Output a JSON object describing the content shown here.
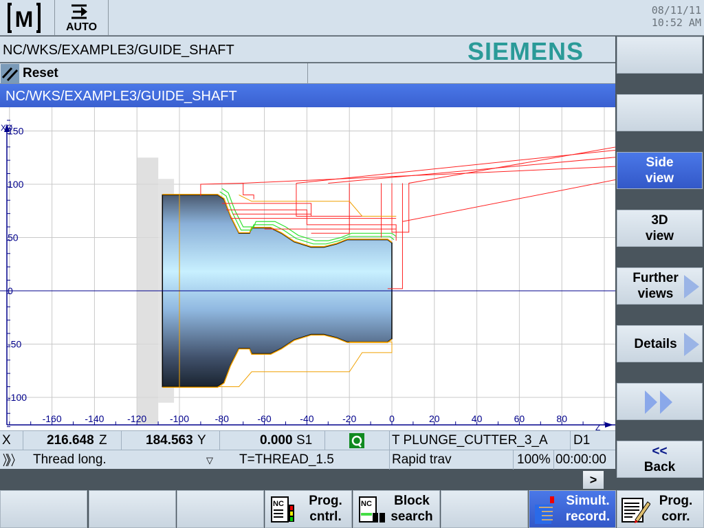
{
  "header": {
    "mode_icon": "machine-M-icon",
    "mode_label": "AUTO",
    "date": "08/11/11",
    "time": "10:52 AM"
  },
  "program_path": "NC/WKS/EXAMPLE3/GUIDE_SHAFT",
  "brand": "SIEMENS",
  "channel_status": "Reset",
  "window_title": "NC/WKS/EXAMPLE3/GUIDE_SHAFT",
  "plot": {
    "x_axis_label": "Z",
    "y_axis_label": "XØ",
    "x_ticks": [
      "-160",
      "-140",
      "-120",
      "-100",
      "-80",
      "-60",
      "-40",
      "-20",
      "0",
      "20",
      "40",
      "60",
      "80"
    ],
    "y_ticks": [
      "150",
      "100",
      "50",
      "0",
      "-50",
      "-100"
    ],
    "colors": {
      "rapid": "#ff2020",
      "feed": "#f0a000",
      "tool": "#30e030",
      "axis": "#00008b",
      "grid": "#c8c8c8"
    }
  },
  "status": {
    "x_label": "X",
    "x_value": "216.648",
    "z_label": "Z",
    "z_value": "184.563",
    "y_label": "Y",
    "y_value": "0.000",
    "spindle": "S1",
    "tool": "T PLUNGE_CUTTER_3_A",
    "d": "D1",
    "cycle": "Thread long.",
    "cycle_tool": "T=THREAD_1.5",
    "feed_mode": "Rapid trav",
    "override": "100%",
    "time": "00:00:00"
  },
  "right_softkeys": [
    {
      "label1": "",
      "label2": ""
    },
    {
      "label1": "",
      "label2": ""
    },
    {
      "label1": "Side",
      "label2": "view"
    },
    {
      "label1": "3D",
      "label2": "view"
    },
    {
      "label1": "Further",
      "label2": "views"
    },
    {
      "label1": "Details",
      "label2": ""
    },
    {
      "label1": "",
      "label2": ""
    },
    {
      "label1": "<<",
      "label2": "Back"
    }
  ],
  "bottom_softkeys": [
    {
      "label1": "",
      "label2": ""
    },
    {
      "label1": "",
      "label2": ""
    },
    {
      "label1": "",
      "label2": ""
    },
    {
      "label1": "Prog.",
      "label2": "cntrl."
    },
    {
      "label1": "Block",
      "label2": "search"
    },
    {
      "label1": "",
      "label2": ""
    },
    {
      "label1": "Simult.",
      "label2": "record."
    },
    {
      "label1": "Prog.",
      "label2": "corr."
    }
  ],
  "expand_label": ">"
}
